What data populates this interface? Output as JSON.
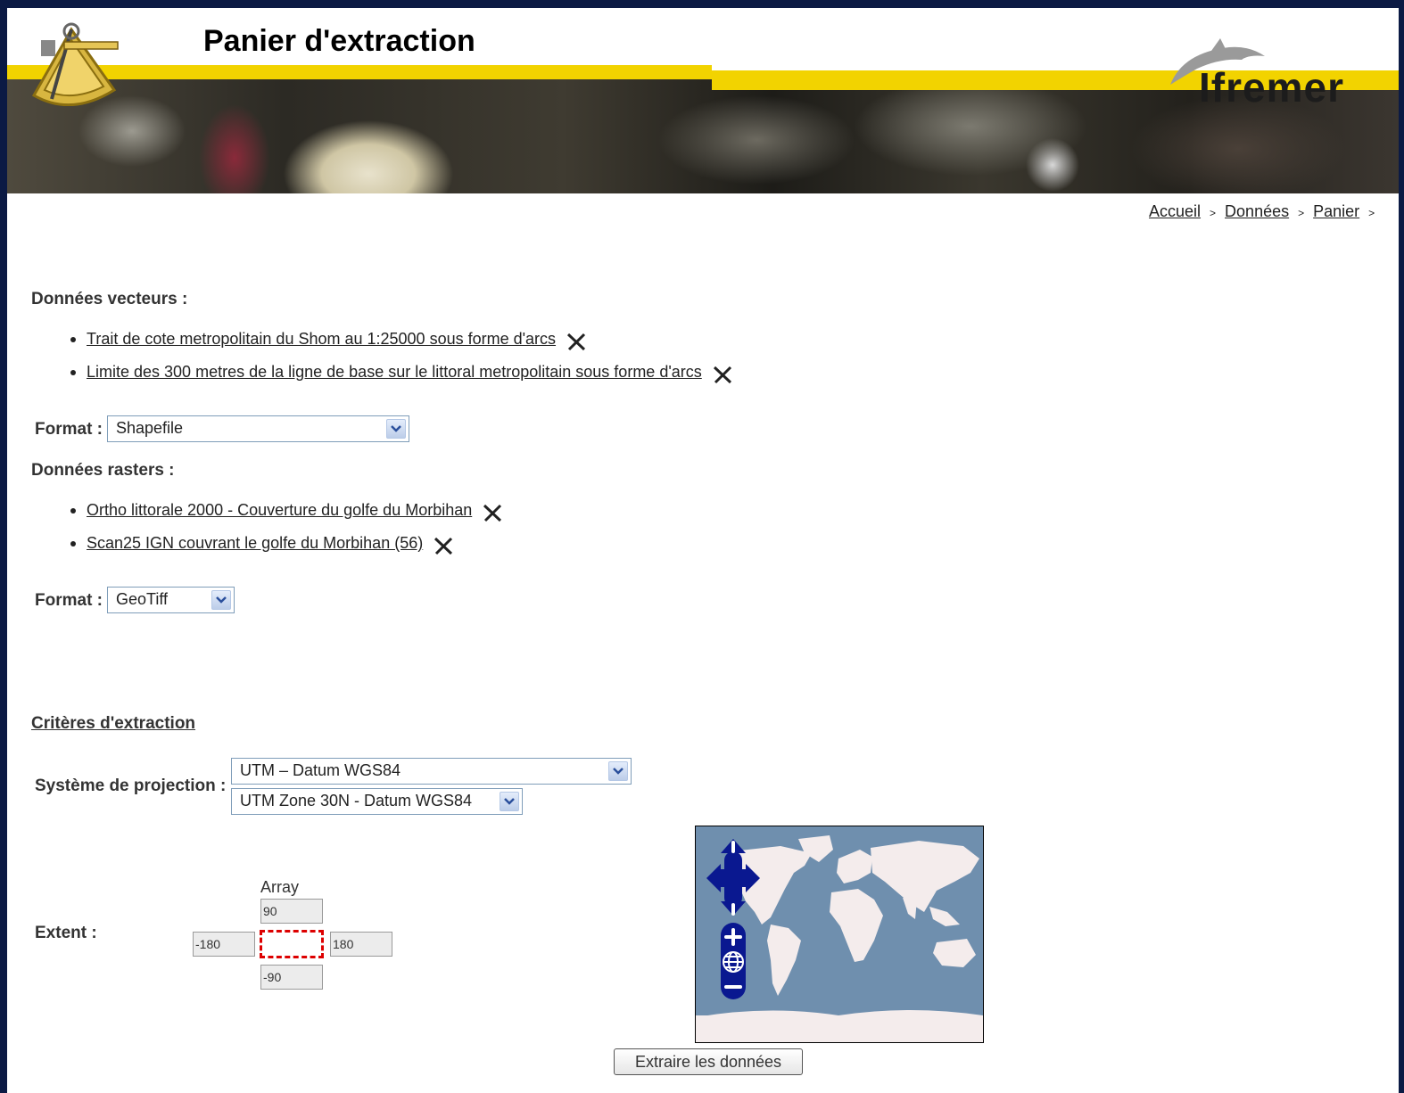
{
  "header": {
    "title": "Panier d'extraction",
    "brand": "Ifremer"
  },
  "breadcrumb": {
    "items": [
      "Accueil",
      "Données",
      "Panier"
    ],
    "separator": ">"
  },
  "vector": {
    "title": "Données vecteurs :",
    "items": [
      "Trait de cote metropolitain du Shom au 1:25000 sous forme d'arcs",
      "Limite des 300 metres de la ligne de base sur le littoral metropolitain sous forme d'arcs"
    ],
    "format_label": "Format :",
    "format_value": "Shapefile"
  },
  "raster": {
    "title": "Données rasters :",
    "items": [
      "Ortho littorale 2000 - Couverture du golfe du Morbihan",
      "Scan25 IGN couvrant le golfe du Morbihan (56)"
    ],
    "format_label": "Format :",
    "format_value": "GeoTiff"
  },
  "criteria": {
    "title": "Critères d'extraction",
    "projection_label": "Système de projection :",
    "projection_value": "UTM – Datum WGS84",
    "zone_value": "UTM Zone 30N - Datum WGS84",
    "extent_label": "Extent :",
    "array_label": "Array",
    "north": "90",
    "south": "-90",
    "west": "-180",
    "east": "180"
  },
  "submit_label": "Extraire les données",
  "colors": {
    "frame": "#0b1a44",
    "yellow": "#f2d300",
    "map_ocean": "#6f8fae",
    "map_controls": "#0a1890",
    "extent_box": "#dd0000"
  },
  "icons": [
    "sextant-logo",
    "dolphin-icon",
    "delete-icon",
    "chevron-down-icon",
    "pan-arrows-icon",
    "zoom-in-icon",
    "zoom-world-icon",
    "zoom-out-icon"
  ]
}
